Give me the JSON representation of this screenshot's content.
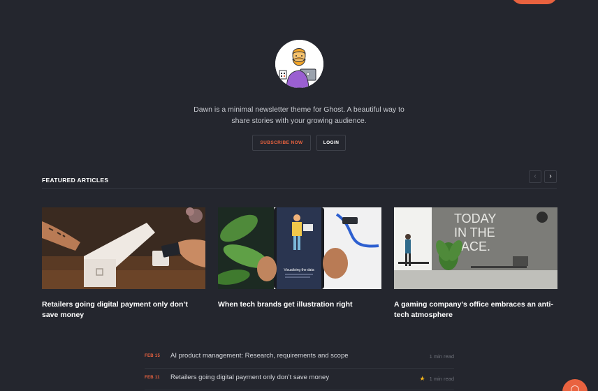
{
  "hero": {
    "tagline_line1": "Dawn is a minimal newsletter theme for Ghost. A beautiful way to",
    "tagline_line2": "share stories with your growing audience.",
    "subscribe_label": "SUBSCRIBE NOW",
    "login_label": "LOGIN"
  },
  "featured": {
    "title": "FEATURED ARTICLES",
    "prev_icon": "‹",
    "next_icon": "›",
    "cards": [
      {
        "title": "Retailers going digital payment only don’t save money",
        "image": "payment-terminal-photo"
      },
      {
        "title": "When tech brands get illustration right",
        "image": "phone-illustration-photo",
        "phone_caption": "Visualising the data"
      },
      {
        "title": "A gaming company’s office embraces an anti-tech atmosphere",
        "image": "office-photo",
        "wall_text": [
          "TODAY",
          "IN THE",
          "FACE."
        ]
      }
    ]
  },
  "latest": [
    {
      "date": "FEB 15",
      "title": "AI product management: Research, requirements and scope",
      "read_time": "1 min read",
      "featured": false
    },
    {
      "date": "FEB 11",
      "title": "Retailers going digital payment only don’t save money",
      "read_time": "1 min read",
      "featured": true
    }
  ],
  "colors": {
    "background": "#24262e",
    "accent": "#e9623f",
    "star": "#f2b31a"
  },
  "icons": {
    "star": "★",
    "fab": "fingerprint-icon"
  }
}
